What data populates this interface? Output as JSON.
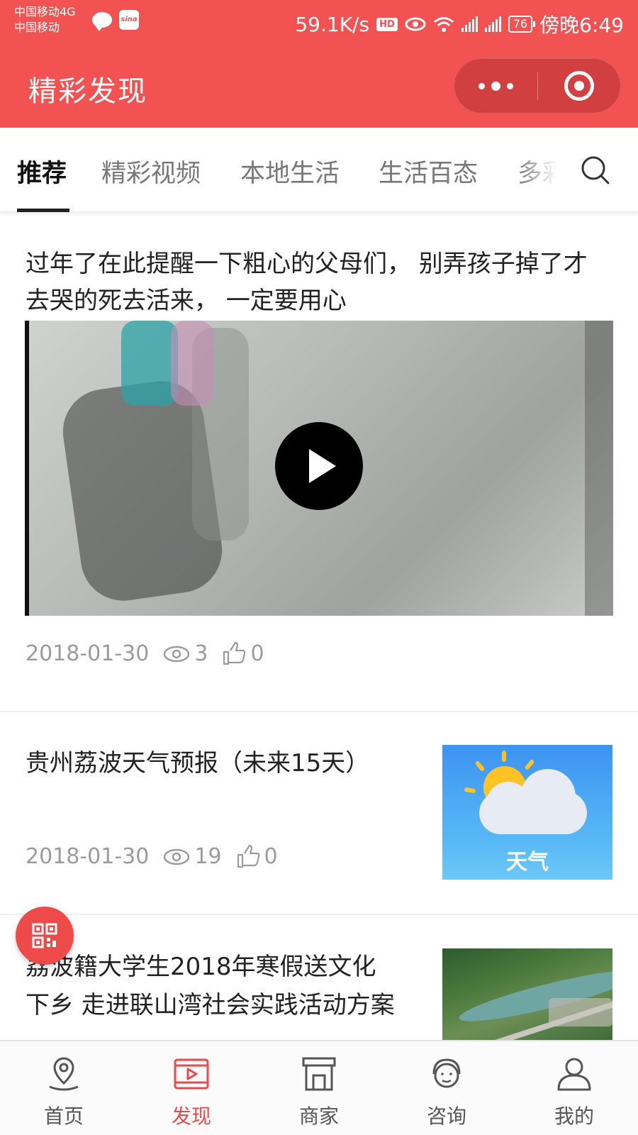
{
  "status_bar": {
    "carrier_1": "中国移动4G",
    "carrier_2": "中国移动",
    "speed": "59.1K/s",
    "hd": "HD",
    "battery": "76",
    "time": "傍晚6:49"
  },
  "header": {
    "title": "精彩发现"
  },
  "tabs": [
    {
      "label": "推荐",
      "active": true
    },
    {
      "label": "精彩视频",
      "active": false
    },
    {
      "label": "本地生活",
      "active": false
    },
    {
      "label": "生活百态",
      "active": false
    },
    {
      "label": "多彩",
      "active": false
    }
  ],
  "articles": [
    {
      "title": "过年了在此提醒一下粗心的父母们， 别弄孩子掉了才去哭的死去活来， 一定要用心",
      "date": "2018-01-30",
      "views": "3",
      "likes": "0",
      "media": "video"
    },
    {
      "title": "贵州荔波天气预报（未来15天）",
      "date": "2018-01-30",
      "views": "19",
      "likes": "0",
      "thumb_label": "天气"
    },
    {
      "title_line1": "荔波籍大学生2018年寒假送文化",
      "title_line2": "下乡 走进联山湾社会实践活动方案"
    }
  ],
  "bottom_nav": [
    {
      "label": "首页",
      "icon": "map-pin-icon",
      "active": false
    },
    {
      "label": "发现",
      "icon": "video-play-icon",
      "active": true
    },
    {
      "label": "商家",
      "icon": "store-icon",
      "active": false
    },
    {
      "label": "咨询",
      "icon": "headset-icon",
      "active": false
    },
    {
      "label": "我的",
      "icon": "user-icon",
      "active": false
    }
  ],
  "colors": {
    "brand": "#f25252",
    "active_nav": "#e94a4a",
    "meta_text": "#9b9b9b"
  }
}
